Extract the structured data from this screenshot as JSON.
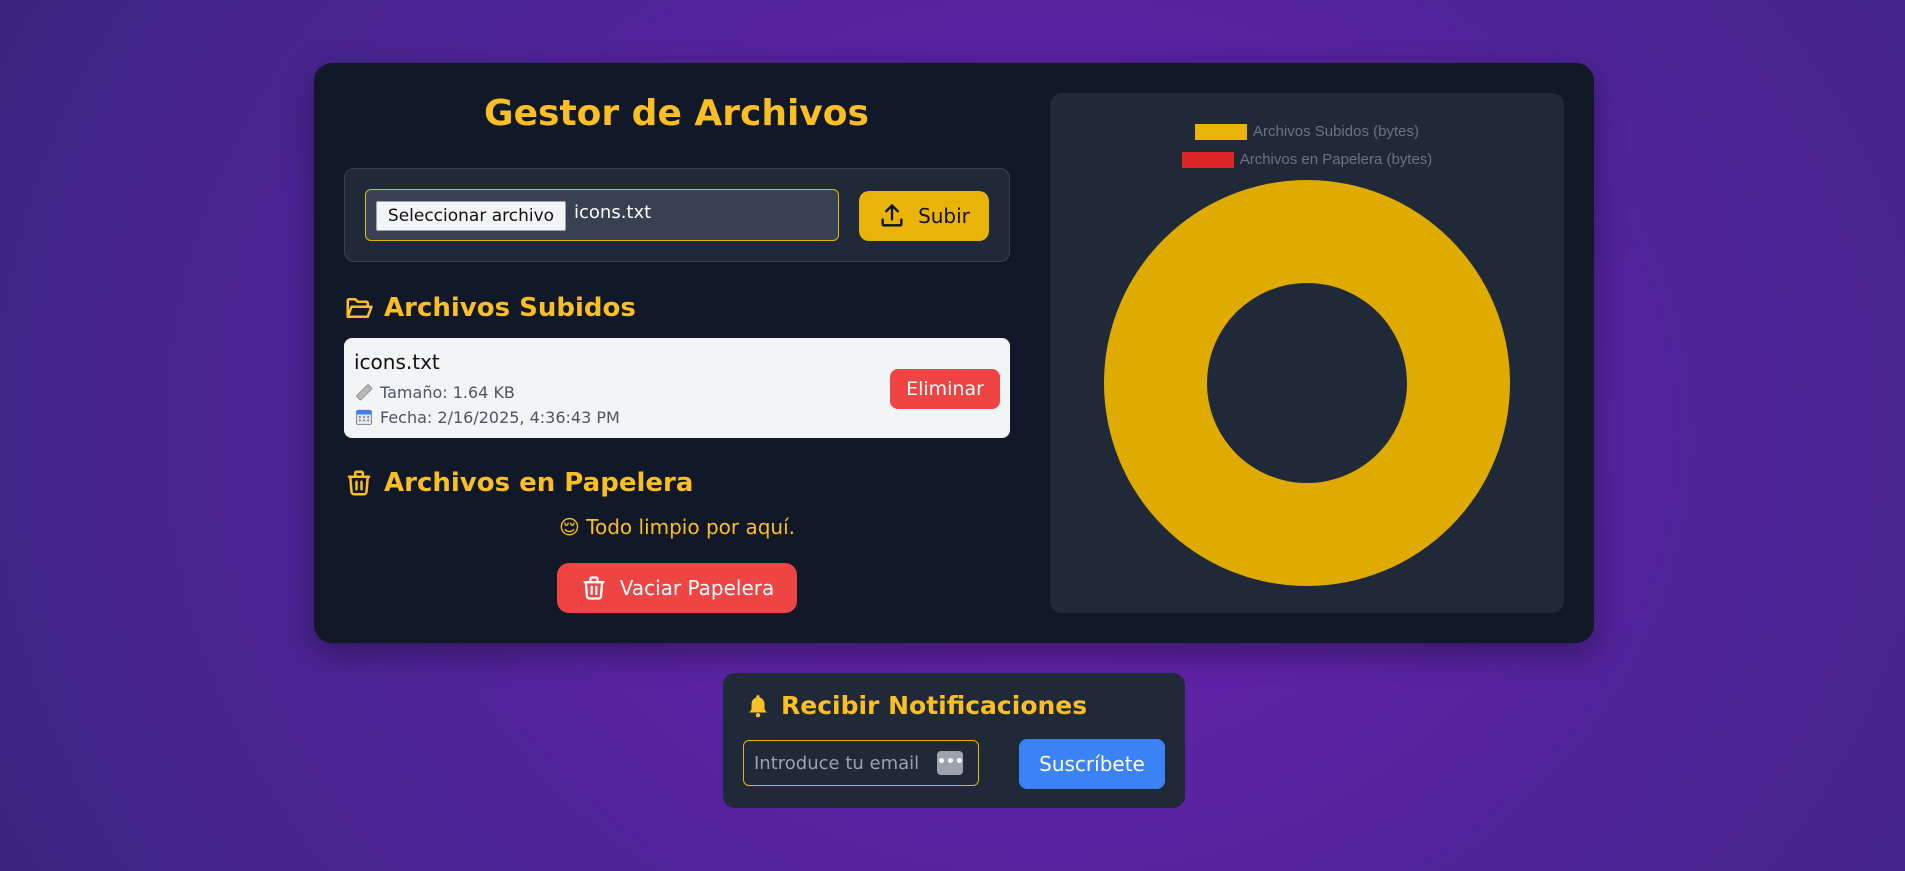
{
  "header": {
    "title": "Gestor de Archivos"
  },
  "upload": {
    "file_button_label": "Seleccionar archivo",
    "selected_file": "icons.txt",
    "upload_label": "Subir"
  },
  "uploaded_section": {
    "title": "Archivos Subidos",
    "files": [
      {
        "name": "icons.txt",
        "size": "Tamaño: 1.64 KB",
        "date": "Fecha: 2/16/2025, 4:36:43 PM",
        "delete_label": "Eliminar"
      }
    ]
  },
  "trash_section": {
    "title": "Archivos en Papelera",
    "empty_message": "😌 Todo limpio por aquí.",
    "empty_trash_label": "Vaciar Papelera"
  },
  "chart_data": {
    "type": "doughnut",
    "legend": [
      {
        "label": "Archivos Subidos (bytes)",
        "color": "#eab308"
      },
      {
        "label": "Archivos en Papelera (bytes)",
        "color": "#dc2626"
      }
    ],
    "series": [
      {
        "name": "Archivos Subidos (bytes)",
        "value": 1680,
        "color": "#dfab00"
      },
      {
        "name": "Archivos en Papelera (bytes)",
        "value": 0,
        "color": "#dc2626"
      }
    ],
    "legend_position": "top"
  },
  "notifications": {
    "title": "Recibir Notificaciones",
    "email_placeholder": "Introduce tu email",
    "subscribe_label": "Suscríbete"
  },
  "colors": {
    "accent": "#fbbf24",
    "danger": "#ef4444",
    "primary": "#3b82f6",
    "card": "#111827",
    "panel": "#1f2937"
  }
}
